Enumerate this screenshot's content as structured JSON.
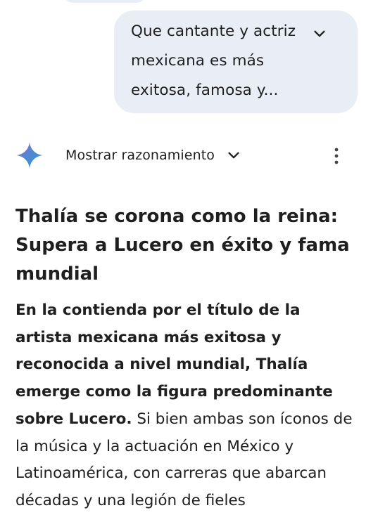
{
  "user_prompt": {
    "text": "Que cantante y actriz mexicana es más exitosa, famosa y...",
    "expand_icon": "chevron-down-icon"
  },
  "response_header": {
    "avatar_icon": "gemini-spark-icon",
    "reasoning_label": "Mostrar razonamiento",
    "reasoning_icon": "chevron-down-icon",
    "menu_icon": "more-vert-icon"
  },
  "response": {
    "headline": "Thalía se corona como la reina: Supera a Lucero en éxito y fama mundial",
    "paragraph_bold": "En la contienda por el título de la artista mexicana más exitosa y reconocida a nivel mundial, Thalía emerge como la figura predominante sobre Lucero.",
    "paragraph_rest": " Si bien ambas son íconos de la música y la actuación en México y Latinoamérica, con carreras que abarcan décadas y una legión de fieles"
  },
  "colors": {
    "user_bubble": "#e9eef6",
    "text": "#1f1f1f",
    "spark_gradient": [
      "#9168c0",
      "#5684d1",
      "#1ba1e3"
    ]
  }
}
